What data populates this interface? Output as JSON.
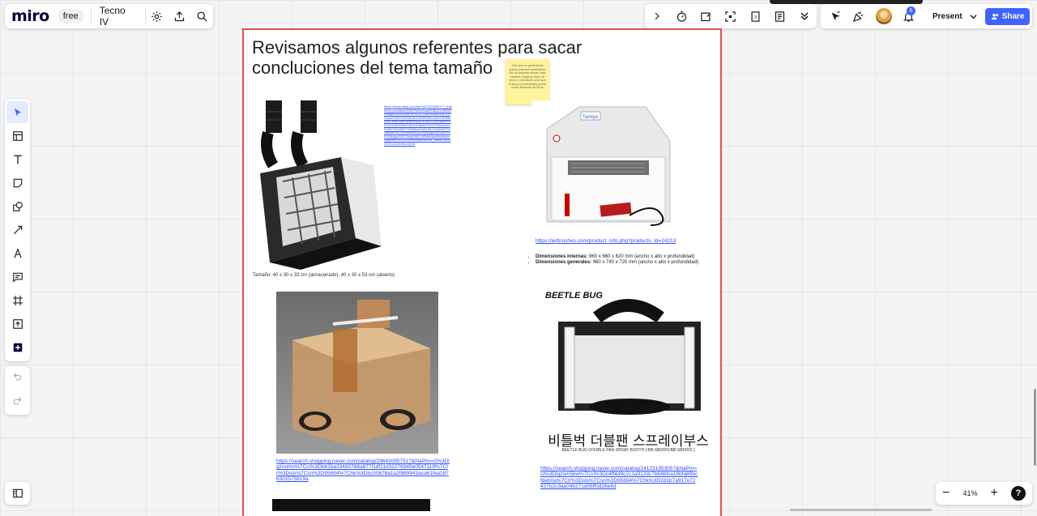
{
  "app": {
    "logo": "miro",
    "plan_badge": "free",
    "board_name": "Tecno IV"
  },
  "collab": {
    "present_label": "Present",
    "share_label": "Share",
    "notification_count": "6"
  },
  "zoom": {
    "level": "41%",
    "minus": "−",
    "plus": "+",
    "help": "?"
  },
  "frame": {
    "title": "Revisamos algunos referentes para sacar concluciones del tema tamaño",
    "sticky_note": "Creo que en general una queria podemos capacitando 8x3 de preparar asume unas medidas maximas 30cm de ancho y una altura como que 6 alsura y profundidad podría existir alrededor de 30cm",
    "item1": {
      "image_alt": "Caja de pintura portátil con dos tubos de extracción",
      "link": "https://www.ebay.com/itm/183743169577?_trkparms=amclksrc%3DITM%26aid%3D1110006%26algo%3DHOMESPLICE.SIM%26ao%3D1%26asc%3D20200818142216%26meid%3D30b0bfc1e6a348b3b9e5e52e2e1a2c23%26pid%3D101196%26rk%3D4%26rkt%3D12%26sd%3D183743169577%26itm%3D183743169577%26pmt%3D1%26noa%3D0%26pg%3D2047675%26algv%3DSimplAMLv9PairwiseWebMskuAspectsV202110NoVariantSeed&_trksid=p2047675.c101196.m2219",
      "caption": "Tamaño: 40 x 30 x 33 cm (almacenado), 40 x 30 x 53 cm (abierto)"
    },
    "item2": {
      "image_alt": "Cabina de pintura blanca Tamiya",
      "link": "https://airbrushes.com/product_info.php?products_id=24213",
      "dims_internal_label": "Dimensiones internas:",
      "dims_internal_value": " 960 x 660 x 620 mm (ancho x alto x profundidad)",
      "dims_general_label": "Dimensiones generales:",
      "dims_general_value": " 960 x 740 x 720 mm (ancho x alto x profundidad)"
    },
    "item3": {
      "image_alt": "Caja de pintura de acrílico y cartón",
      "link": "https://search.shopping.naver.com/catalog/29643095751?&NaPm=ct%3Dlgzoomo%7Cci%3Db61ba33490768a877f1df11d32276945e0547119%7Ctr%3Dsls%7Csn%3D95694%7Chk%3Dbc50678a1a2f889943aca61fea1876302575819a"
    },
    "item4": {
      "image_brand": "BEETLE BUG",
      "image_korean": "비틀벅 더블팬 스프레이부스",
      "image_subtitle": "BEETLE BUG DOUBLE PAN SPRAY BOOTH [ BB-SBD001/BB-SBD002 ]",
      "link": "https://search.shopping.naver.com/catalog/24123195305?&NaPm=ct%3Dlgzom5kw%7Cci%3Dc4ff4d9c2c1a912dc7b64bfca18bfa89bcfdeb0a%7Ctr%3Dsls%7Csn%3D95694%7Chk%3D2d1b7a917e72437b2c3aa046271d06ff0d28e4d"
    }
  },
  "icons": {
    "settings": "gear-icon",
    "export": "upload-icon",
    "search": "search-icon",
    "timer": "timer-icon",
    "present_mode": "screen-icon",
    "select": "cursor-icon",
    "template": "template-icon",
    "text": "text-icon",
    "sticky": "sticky-note-icon",
    "shapes": "shapes-icon",
    "line": "arrow-line-icon",
    "pen": "pen-icon",
    "comment": "comment-icon",
    "frame": "frame-icon",
    "upload": "upload-icon",
    "plus": "plus-icon",
    "undo": "undo-icon",
    "redo": "redo-icon"
  },
  "colors": {
    "accent": "#4262ff",
    "frame_border": "#e0533f",
    "link": "#2b4bff",
    "sticky": "#fff49a"
  }
}
